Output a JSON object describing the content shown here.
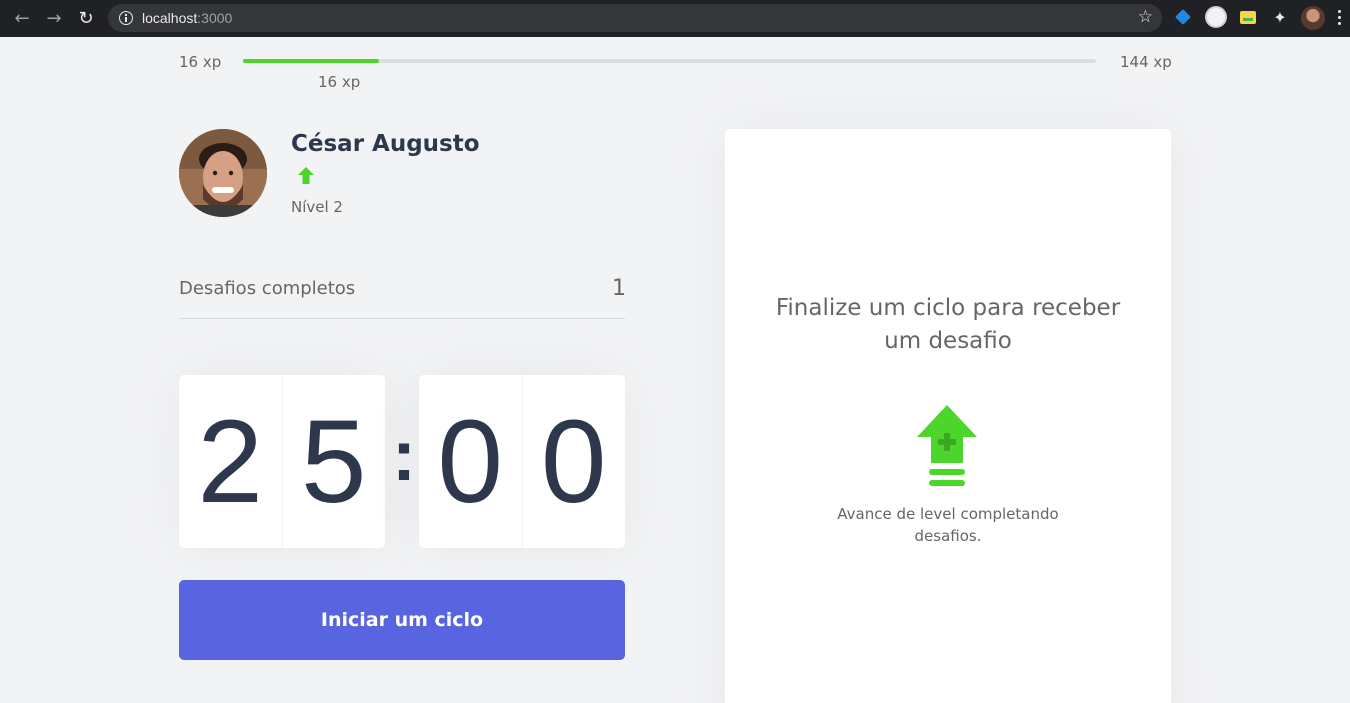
{
  "browser": {
    "url_host": "localhost",
    "url_port": ":3000",
    "back_icon": "arrow-left-icon",
    "forward_icon": "arrow-right-icon",
    "reload_icon": "reload-icon",
    "star_icon": "star-icon"
  },
  "experience": {
    "start_label": "16 xp",
    "current_label": "16 xp",
    "end_label": "144 xp",
    "progress_fraction": 0.16,
    "bar_color": "#4cd62b"
  },
  "profile": {
    "name": "César Augusto",
    "level_text": "Nível 2",
    "level_icon": "level-up-arrow-icon"
  },
  "challenges": {
    "label": "Desafios completos",
    "count": "1"
  },
  "countdown": {
    "minute_left": "2",
    "minute_right": "5",
    "separator": ":",
    "second_left": "0",
    "second_right": "0"
  },
  "start_button": {
    "label": "Iniciar um ciclo",
    "color": "#5965e0"
  },
  "challenge_card": {
    "title": "Finalize um ciclo para receber um desafio",
    "subtitle": "Avance de level completando desafios.",
    "icon": "level-up-icon"
  },
  "colors": {
    "background": "#f2f3f5",
    "title_text": "#2e384d",
    "body_text": "#666666",
    "accent_green": "#4cd62b"
  }
}
